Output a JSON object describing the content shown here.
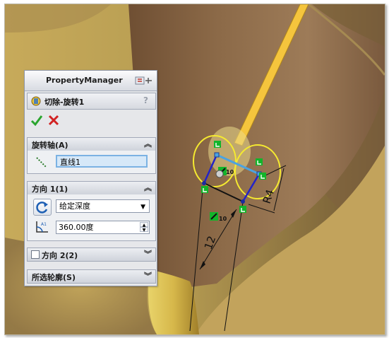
{
  "property_manager": {
    "title": "PropertyManager",
    "feature_name": "切除-旋转1",
    "help": "?",
    "groups": {
      "axis": {
        "label": "旋转轴(A)",
        "value": "直线1"
      },
      "direction1": {
        "label": "方向 1(1)",
        "end_condition": "给定深度",
        "angle": "360.00度"
      },
      "direction2": {
        "label": "方向 2(2)",
        "checked": false
      },
      "contours": {
        "label": "所选轮廓(S)"
      }
    }
  },
  "viewport": {
    "dimensions": {
      "length": "12",
      "radius": "R4"
    },
    "relation_tags": {
      "equal_tag": "10",
      "equal_tag_2": "10"
    }
  },
  "colors": {
    "model_gold": "#c8a457",
    "model_shadow": "#7a5a3c",
    "sketch_blue": "#2323c8",
    "axis_line": "#4ba3e0",
    "preview_yellow": "#f5ea30",
    "relation_green": "#12b52a"
  },
  "icons": {
    "feature": "cut-revolve-icon",
    "ok": "checkmark-icon",
    "cancel": "cross-icon",
    "axis": "line-axis-icon",
    "reverse": "reverse-direction-icon",
    "angle": "angle-icon"
  }
}
